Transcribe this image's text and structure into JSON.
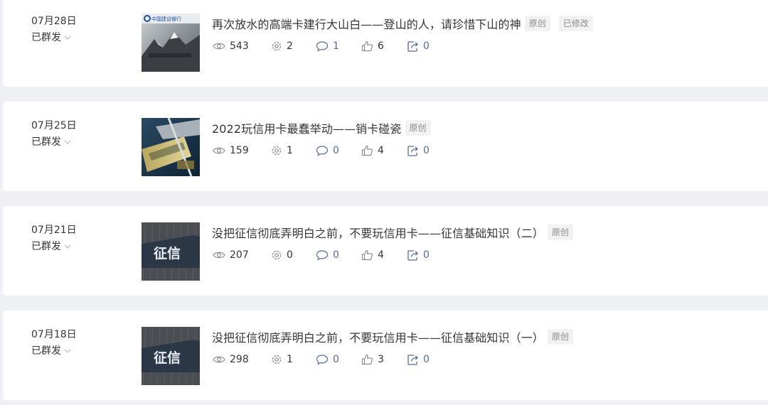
{
  "posts": [
    {
      "date": "07月28日",
      "status": "已群发",
      "title": "再次放水的高端卡建行大山白——登山的人，请珍惜下山的神",
      "tags": [
        "原创",
        "已修改"
      ],
      "views": "543",
      "settings": "2",
      "comments": "1",
      "likes": "6",
      "shares": "0",
      "thumb_text": "中国建设银行"
    },
    {
      "date": "07月25日",
      "status": "已群发",
      "title": "2022玩信用卡最蠢举动——销卡碰瓷",
      "tags": [
        "原创"
      ],
      "views": "159",
      "settings": "1",
      "comments": "0",
      "likes": "4",
      "shares": "0"
    },
    {
      "date": "07月21日",
      "status": "已群发",
      "title": "没把征信彻底弄明白之前，不要玩信用卡——征信基础知识（二）",
      "tags": [
        "原创"
      ],
      "views": "207",
      "settings": "0",
      "comments": "0",
      "likes": "4",
      "shares": "0",
      "thumb_text": "征信"
    },
    {
      "date": "07月18日",
      "status": "已群发",
      "title": "没把征信彻底弄明白之前，不要玩信用卡——征信基础知识（一）",
      "tags": [
        "原创"
      ],
      "views": "298",
      "settings": "1",
      "comments": "0",
      "likes": "3",
      "shares": "0",
      "thumb_text": "征信"
    }
  ],
  "colors": {
    "accent": "#576b95",
    "background": "#eef0f3",
    "card": "#ffffff",
    "tag_bg": "#f2f2f2"
  },
  "icons": [
    "chevron-down-icon",
    "eye-icon",
    "gear-icon",
    "comment-icon",
    "thumbs-up-icon",
    "share-icon"
  ]
}
